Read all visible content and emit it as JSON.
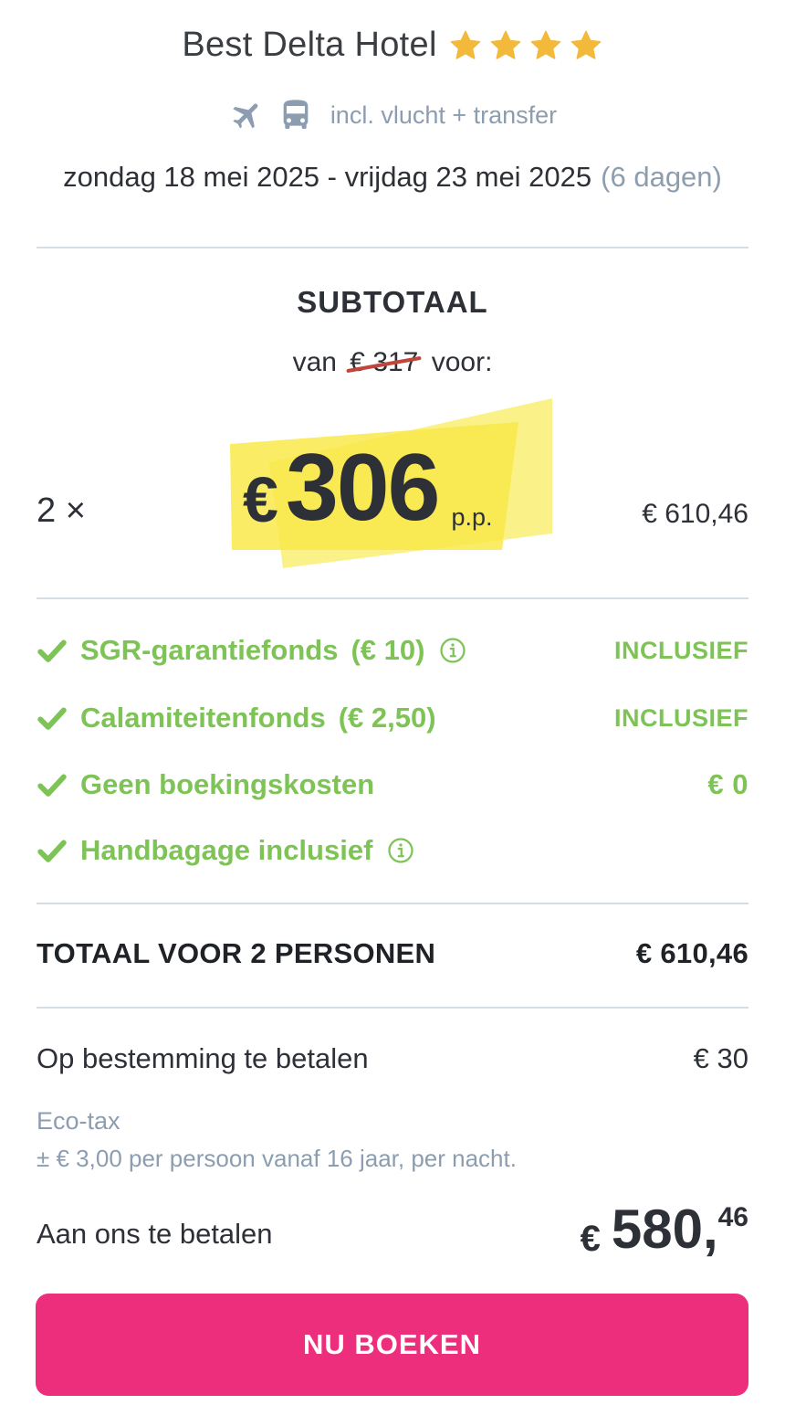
{
  "hotel": {
    "name": "Best Delta Hotel",
    "stars": 4,
    "included": "incl. vlucht + transfer",
    "dates": "zondag 18 mei 2025 - vrijdag 23 mei 2025",
    "duration": "(6 dagen)"
  },
  "subtotal": {
    "title": "SUBTOTAAL",
    "from_prefix": "van",
    "old_price": "€ 317",
    "from_suffix": "voor:",
    "quantity": "2 ×",
    "currency": "€",
    "price": "306",
    "per_person": "p.p.",
    "line_total": "€ 610,46"
  },
  "inclusions": [
    {
      "label": "SGR-garantiefonds",
      "detail": "(€ 10)",
      "value": "INCLUSIEF",
      "info": true
    },
    {
      "label": "Calamiteitenfonds",
      "detail": "(€ 2,50)",
      "value": "INCLUSIEF",
      "info": false
    },
    {
      "label": "Geen boekingskosten",
      "detail": "",
      "value": "€ 0",
      "info": false
    },
    {
      "label": "Handbagage inclusief",
      "detail": "",
      "value": "",
      "info": true
    }
  ],
  "total": {
    "label": "TOTAAL VOOR 2 PERSONEN",
    "value": "€ 610,46"
  },
  "destination": {
    "label": "Op bestemming te betalen",
    "value": "€ 30",
    "eco_title": "Eco-tax",
    "eco_desc": "± € 3,00 per persoon vanaf 16 jaar, per nacht."
  },
  "payment": {
    "label": "Aan ons te betalen",
    "currency": "€",
    "amount_int": "580,",
    "amount_cents": "46"
  },
  "book_button": "NU BOEKEN",
  "colors": {
    "accent_pink": "#ec2e7c",
    "success_green": "#7dc355",
    "star_gold": "#f2b93b",
    "highlight_yellow": "#f9e94a",
    "muted_blue_gray": "#8c9db0",
    "divider": "#d4dde6"
  },
  "icons": [
    "star-icon",
    "plane-icon",
    "bus-icon",
    "check-icon",
    "info-icon"
  ]
}
